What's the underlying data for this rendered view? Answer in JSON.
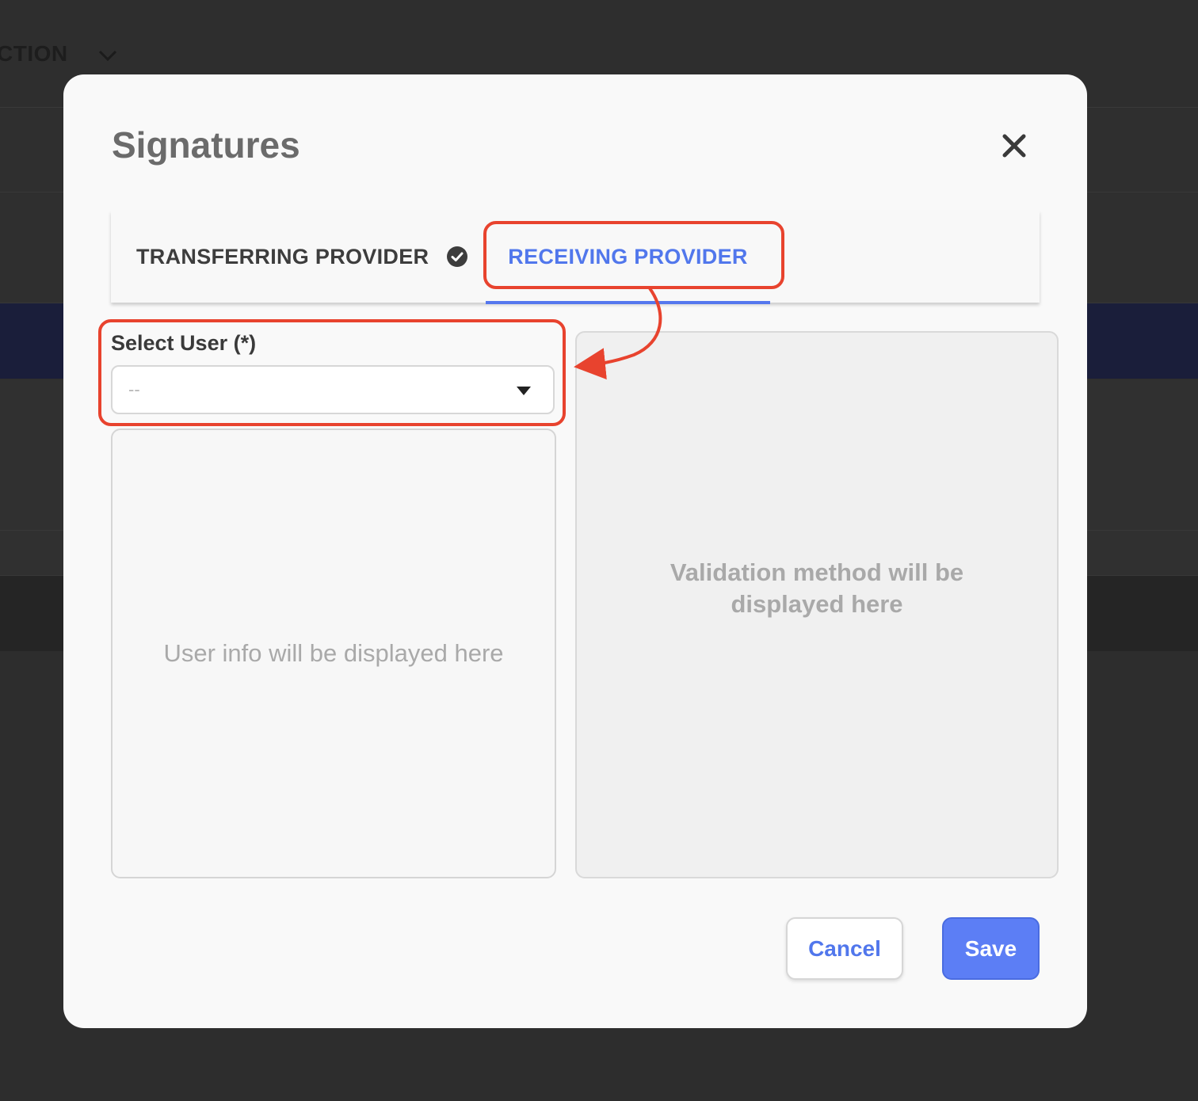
{
  "background": {
    "header_label": "CTION"
  },
  "modal": {
    "title": "Signatures",
    "tabs": [
      {
        "label": "TRANSFERRING PROVIDER",
        "completed": true,
        "active": false
      },
      {
        "label": "RECEIVING PROVIDER",
        "completed": false,
        "active": true
      }
    ],
    "select_user": {
      "label": "Select User (*)",
      "value": "--"
    },
    "user_info_placeholder": "User info will be displayed here",
    "validation_placeholder": "Validation method will be displayed here",
    "buttons": {
      "cancel": "Cancel",
      "save": "Save"
    }
  },
  "colors": {
    "accent": "#5577EE",
    "annotation": "#E8432E",
    "overlay": "#2D2D2D"
  },
  "icons": {
    "close": "close-icon",
    "tab_check": "check-circle-icon",
    "select_caret": "caret-down-icon",
    "header_chevron": "chevron-down-icon"
  }
}
